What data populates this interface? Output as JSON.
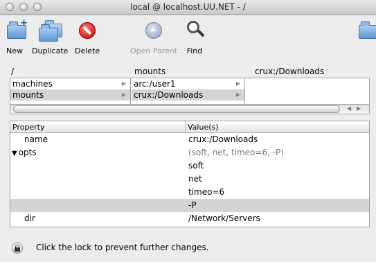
{
  "window": {
    "title": "local @ localhost.UU.NET - /"
  },
  "toolbar": {
    "new_label": "New",
    "duplicate_label": "Duplicate",
    "delete_label": "Delete",
    "open_parent_label": "Open Parent",
    "find_label": "Find"
  },
  "browser": {
    "headers": [
      "/",
      "mounts",
      "crux:/Downloads"
    ],
    "col1": [
      "machines",
      "mounts"
    ],
    "col2": [
      "arc:/user1",
      "crux:/Downloads"
    ]
  },
  "table": {
    "columns": [
      "Property",
      "Value(s)"
    ],
    "rows": [
      {
        "key": "name",
        "value": "crux:/Downloads"
      },
      {
        "key": "opts",
        "value": "(soft, net, timeo=6, -P)"
      },
      {
        "key": "",
        "value": "soft"
      },
      {
        "key": "",
        "value": "net"
      },
      {
        "key": "",
        "value": "timeo=6"
      },
      {
        "key": "",
        "value": "-P"
      },
      {
        "key": "dir",
        "value": "/Network/Servers"
      }
    ]
  },
  "status": {
    "lock_message": "Click the lock to prevent further changes."
  }
}
